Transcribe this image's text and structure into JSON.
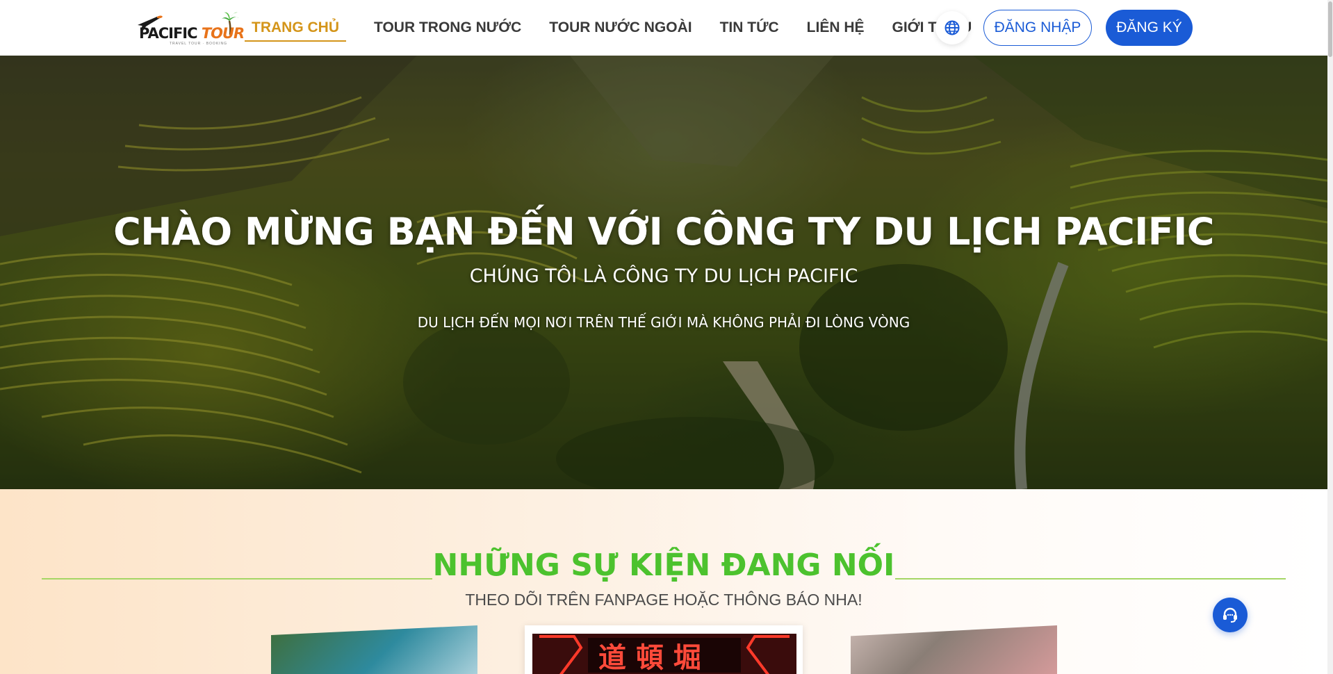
{
  "brand": {
    "logo_main": "PACIFIC",
    "logo_accent": "TOUR",
    "logo_tagline": "TRAVEL TOUR · BOOKING"
  },
  "nav": {
    "items": [
      {
        "label": "TRANG CHỦ",
        "active": true
      },
      {
        "label": "TOUR TRONG NƯỚC",
        "active": false
      },
      {
        "label": "TOUR NƯỚC NGOÀI",
        "active": false
      },
      {
        "label": "TIN TỨC",
        "active": false
      },
      {
        "label": "LIÊN HỆ",
        "active": false
      },
      {
        "label": "GIỚI THIỆU",
        "active": false
      }
    ],
    "language_icon": "globe-icon",
    "login_label": "ĐĂNG NHẬP",
    "register_label": "ĐĂNG KÝ"
  },
  "hero": {
    "title": "CHÀO MỪNG BẠN ĐẾN VỚI CÔNG TY DU LỊCH PACIFIC",
    "subtitle": "CHÚNG TÔI LÀ CÔNG TY DU LỊCH PACIFIC",
    "tagline": "DU LỊCH ĐẾN MỌI NƠI TRÊN THẾ GIỚI MÀ KHÔNG PHẢI ĐI LÒNG VÒNG"
  },
  "events": {
    "title": "NHỮNG SỰ KIỆN ĐANG NỐI",
    "subtitle": "THEO DÕI TRÊN FANPAGE HOẶC THÔNG BÁO NHA!"
  },
  "support": {
    "icon": "headset-icon"
  },
  "colors": {
    "accent_nav": "#d4951a",
    "primary_blue": "#1a5bd6",
    "events_green": "#4cc22e",
    "events_line": "#a5d665"
  }
}
